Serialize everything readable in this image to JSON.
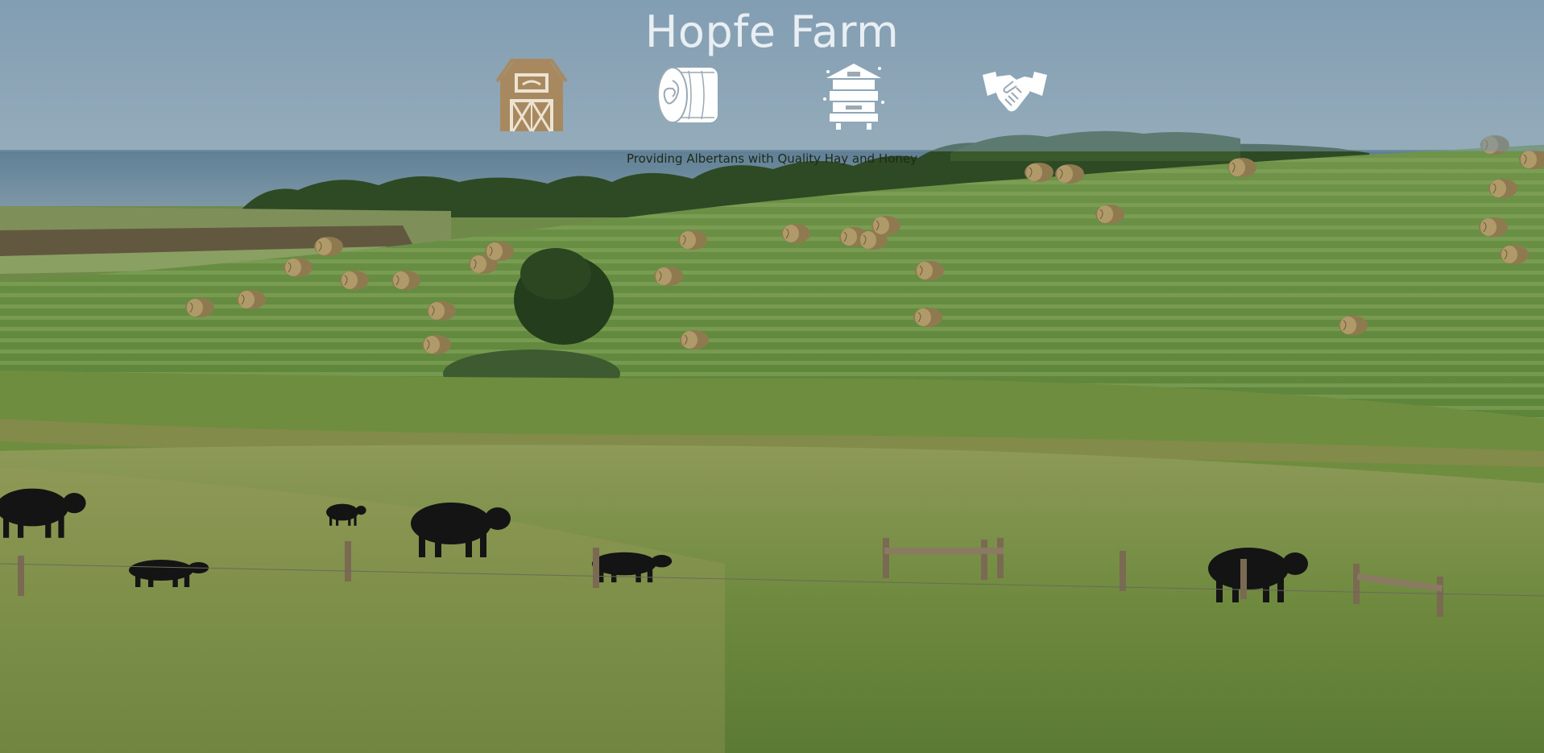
{
  "site": {
    "title": "Hopfe Farm",
    "tagline": "Providing Albertans with Quality Hay and Honey"
  },
  "nav": {
    "items": [
      {
        "icon": "barn-icon",
        "color": "#a8895f"
      },
      {
        "icon": "hay-bale-icon",
        "color": "#ffffff"
      },
      {
        "icon": "beehive-icon",
        "color": "#ffffff"
      },
      {
        "icon": "handshake-icon",
        "color": "#ffffff"
      }
    ]
  },
  "colors": {
    "header_overlay": "#7896aa",
    "title_text": "#e8eef2",
    "tagline_text": "#1e2a16",
    "barn_accent": "#a8895f"
  }
}
